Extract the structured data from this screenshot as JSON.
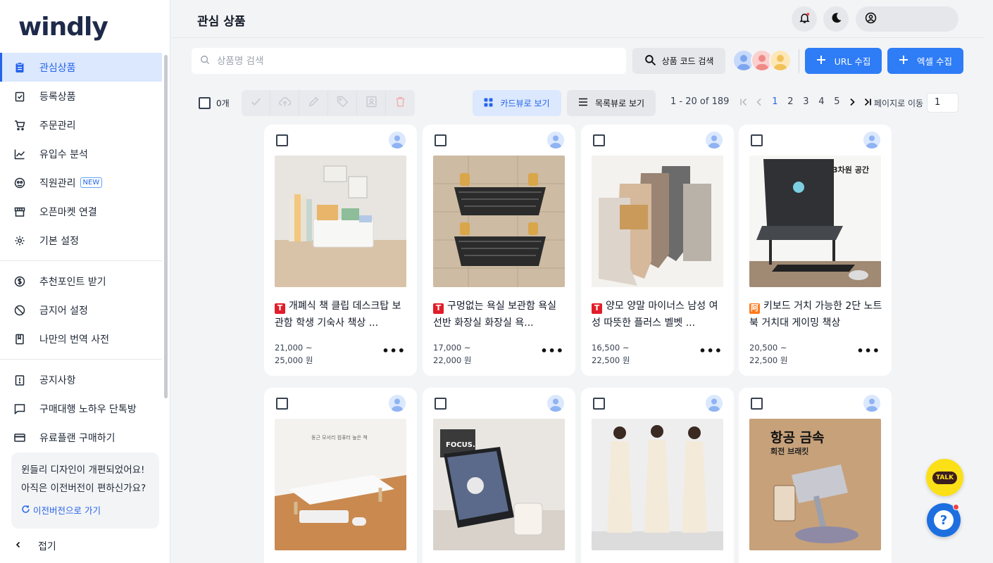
{
  "app": {
    "logo": "windly"
  },
  "colors": {
    "accent": "#2e7cf6",
    "active_bg": "#dbe8fd",
    "kakao": "#fbe018"
  },
  "sidebar": {
    "items": [
      {
        "label": "관심상품",
        "icon": "clipboard-icon"
      },
      {
        "label": "등록상품",
        "icon": "checklist-icon"
      },
      {
        "label": "주문관리",
        "icon": "cart-icon"
      },
      {
        "label": "유입수 분석",
        "icon": "chart-line-icon"
      },
      {
        "label": "직원관리",
        "icon": "people-icon",
        "badge": "NEW"
      },
      {
        "label": "오픈마켓 연결",
        "icon": "store-icon"
      },
      {
        "label": "기본 설정",
        "icon": "gear-icon"
      }
    ],
    "items2": [
      {
        "label": "추천포인트 받기",
        "icon": "dollar-icon"
      },
      {
        "label": "금지어 설정",
        "icon": "ban-icon"
      },
      {
        "label": "나만의 번역 사전",
        "icon": "book-icon"
      }
    ],
    "items3": [
      {
        "label": "공지사항",
        "icon": "notice-icon"
      },
      {
        "label": "구매대행 노하우 단톡방",
        "icon": "chat-icon"
      },
      {
        "label": "유료플랜 구매하기",
        "icon": "card-icon"
      }
    ],
    "notice": {
      "line1": "윈들리 디자인이 개편되었어요!",
      "line2": "아직은 이전버전이 편하신가요?",
      "link": "이전버전으로 가기"
    },
    "collapse": "접기"
  },
  "header": {
    "title": "관심 상품"
  },
  "search": {
    "placeholder": "상품명 검색",
    "code_button": "상품 코드 검색"
  },
  "buttons": {
    "url_collect": "URL 수집",
    "excel_collect": "엑셀 수집"
  },
  "toolbar": {
    "selected_count": "0개",
    "card_view": "카드뷰로 보기",
    "list_view": "목록뷰로 보기"
  },
  "pagination": {
    "range": "1 - 20 of 189",
    "pages": [
      "1",
      "2",
      "3",
      "4",
      "5"
    ],
    "current": "1",
    "goto_label": "페이지로 이동",
    "goto_value": "1"
  },
  "products": [
    {
      "market": "T",
      "title": "개폐식 책 클립 데스크탑 보관함 학생 기숙사 책상 ...",
      "price_min": "21,000 ~",
      "price_max": "25,000 원",
      "image": "desk-organizer"
    },
    {
      "market": "T",
      "title": "구멍없는 욕실 보관함 욕실 선반 화장실 화장실 욕...",
      "price_min": "17,000 ~",
      "price_max": "22,000 원",
      "image": "bath-shelf"
    },
    {
      "market": "T",
      "title": "양모 양말 마이너스 남성 여성 따뜻한 플러스 벨벳 ...",
      "price_min": "16,500 ~",
      "price_max": "22,500 원",
      "image": "wool-socks"
    },
    {
      "market": "A",
      "title": "키보드 거치 가능한 2단 노트북 거치대 게이밍 책상",
      "price_min": "20,500 ~",
      "price_max": "22,500 원",
      "image": "laptop-stand"
    },
    {
      "market": "",
      "title": "",
      "price_min": "",
      "price_max": "",
      "image": "monitor-stand"
    },
    {
      "market": "",
      "title": "",
      "price_min": "",
      "price_max": "",
      "image": "tablet-holder"
    },
    {
      "market": "",
      "title": "",
      "price_min": "",
      "price_max": "",
      "image": "knit-dress"
    },
    {
      "market": "",
      "title": "",
      "price_min": "",
      "price_max": "",
      "image": "phone-stand"
    }
  ],
  "image_text": {
    "laptop_title": "3차원 공간",
    "phone_title": "항공 금속",
    "phone_sub": "회전 브래킷",
    "monitor_caption": "동근 모서리 컴퓨터 높은 책",
    "tablet_focus": "FOCUS."
  },
  "floating": {
    "talk": "TALK",
    "help": "?"
  }
}
